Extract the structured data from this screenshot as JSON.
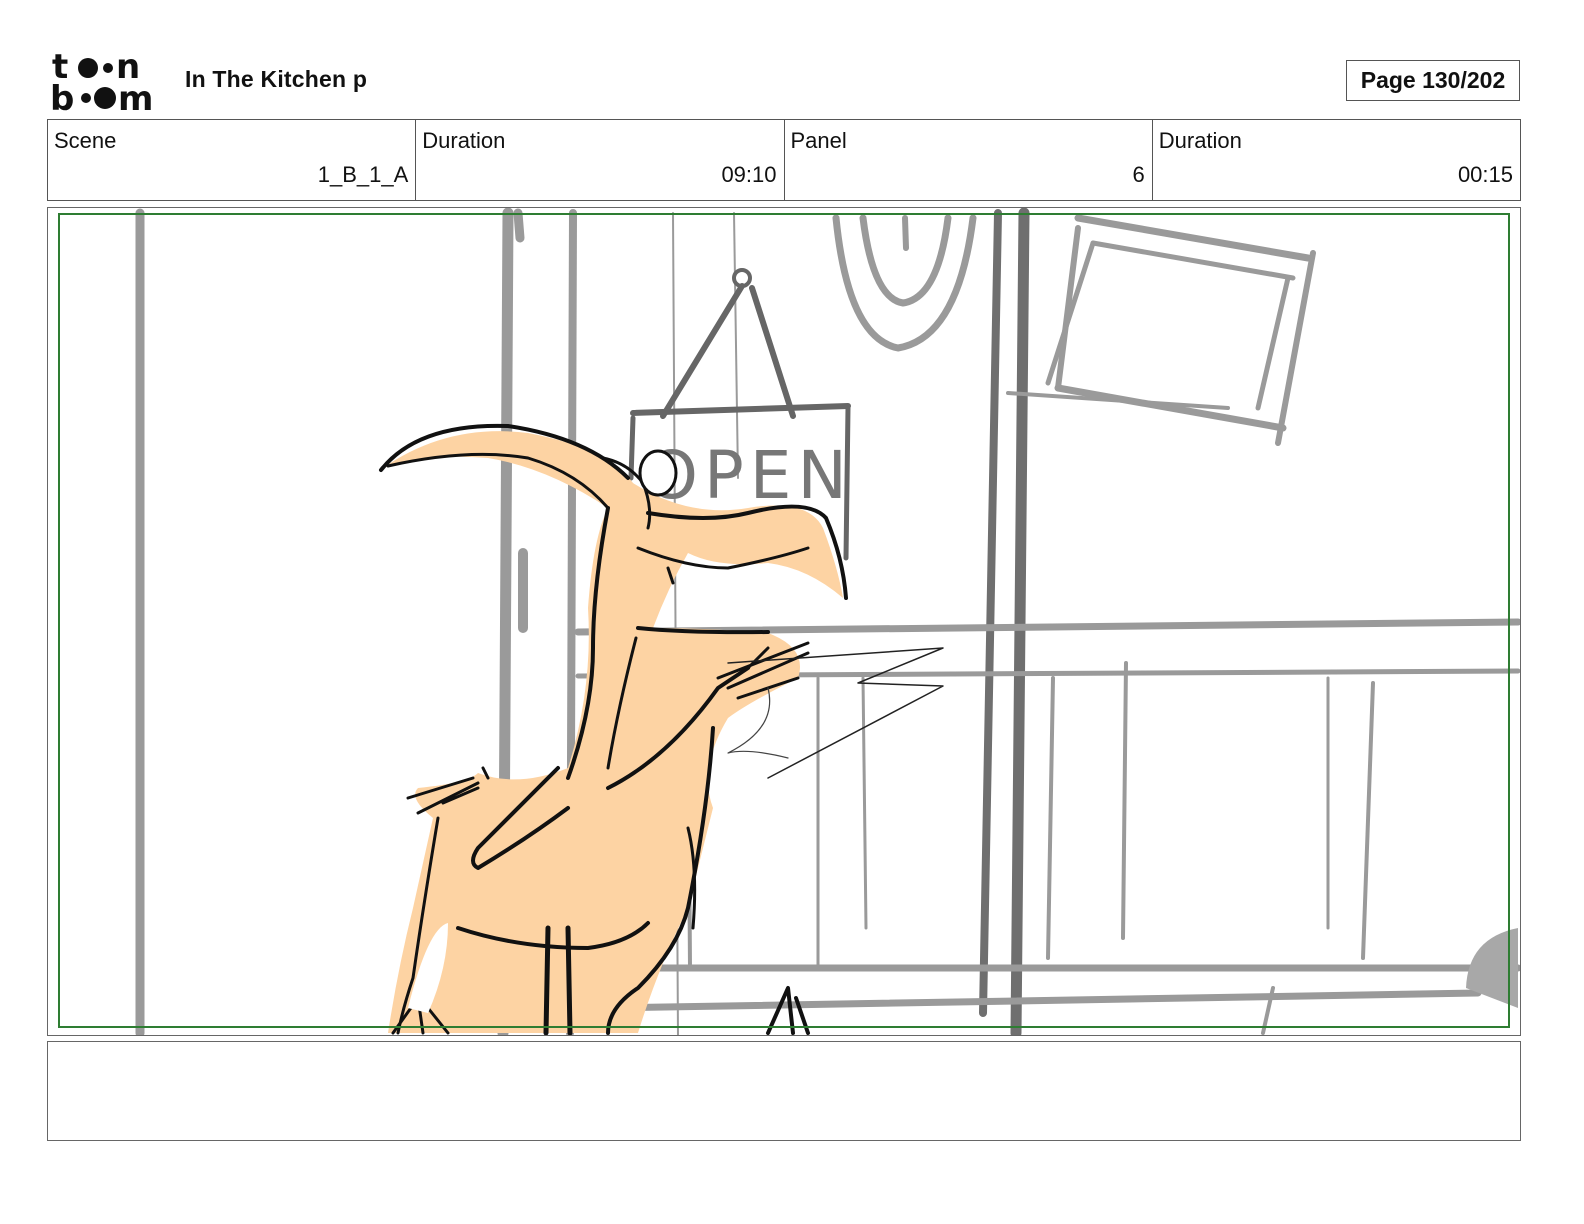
{
  "header": {
    "logo_text": "toon boom",
    "project_title": "In The Kitchen  p",
    "page_label": "Page 130/202"
  },
  "info": {
    "scene_label": "Scene",
    "scene_value": "1_B_1_A",
    "scene_duration_label": "Duration",
    "scene_duration_value": "09:10",
    "panel_label": "Panel",
    "panel_value": "6",
    "panel_duration_label": "Duration",
    "panel_duration_value": "00:15"
  },
  "panel": {
    "sign_text": "OPEN",
    "colors": {
      "safe_frame": "#2e7d32",
      "background_lines": "#9a9a9a",
      "character_fill": "#fdd3a3",
      "ink": "#111111"
    }
  },
  "notes": {
    "text": ""
  }
}
